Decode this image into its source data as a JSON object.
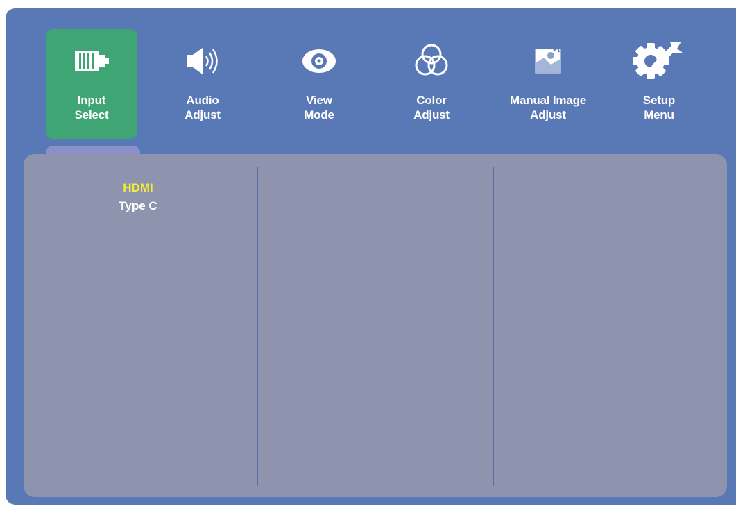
{
  "colors": {
    "frame": "#5978b6",
    "active_tab": "#3fa574",
    "panel": "#8f94ae",
    "selected_option": "#f2ee3a"
  },
  "tabs": [
    {
      "label": "Input\nSelect",
      "icon": "input-connector-icon",
      "active": true
    },
    {
      "label": "Audio\nAdjust",
      "icon": "speaker-icon",
      "active": false
    },
    {
      "label": "View\nMode",
      "icon": "eye-icon",
      "active": false
    },
    {
      "label": "Color\nAdjust",
      "icon": "color-circles-icon",
      "active": false
    },
    {
      "label": "Manual Image\nAdjust",
      "icon": "image-adjust-icon",
      "active": false
    },
    {
      "label": "Setup\nMenu",
      "icon": "gear-wrench-icon",
      "active": false
    }
  ],
  "input_options": [
    {
      "label": "HDMI",
      "selected": true
    },
    {
      "label": "Type C",
      "selected": false
    }
  ]
}
